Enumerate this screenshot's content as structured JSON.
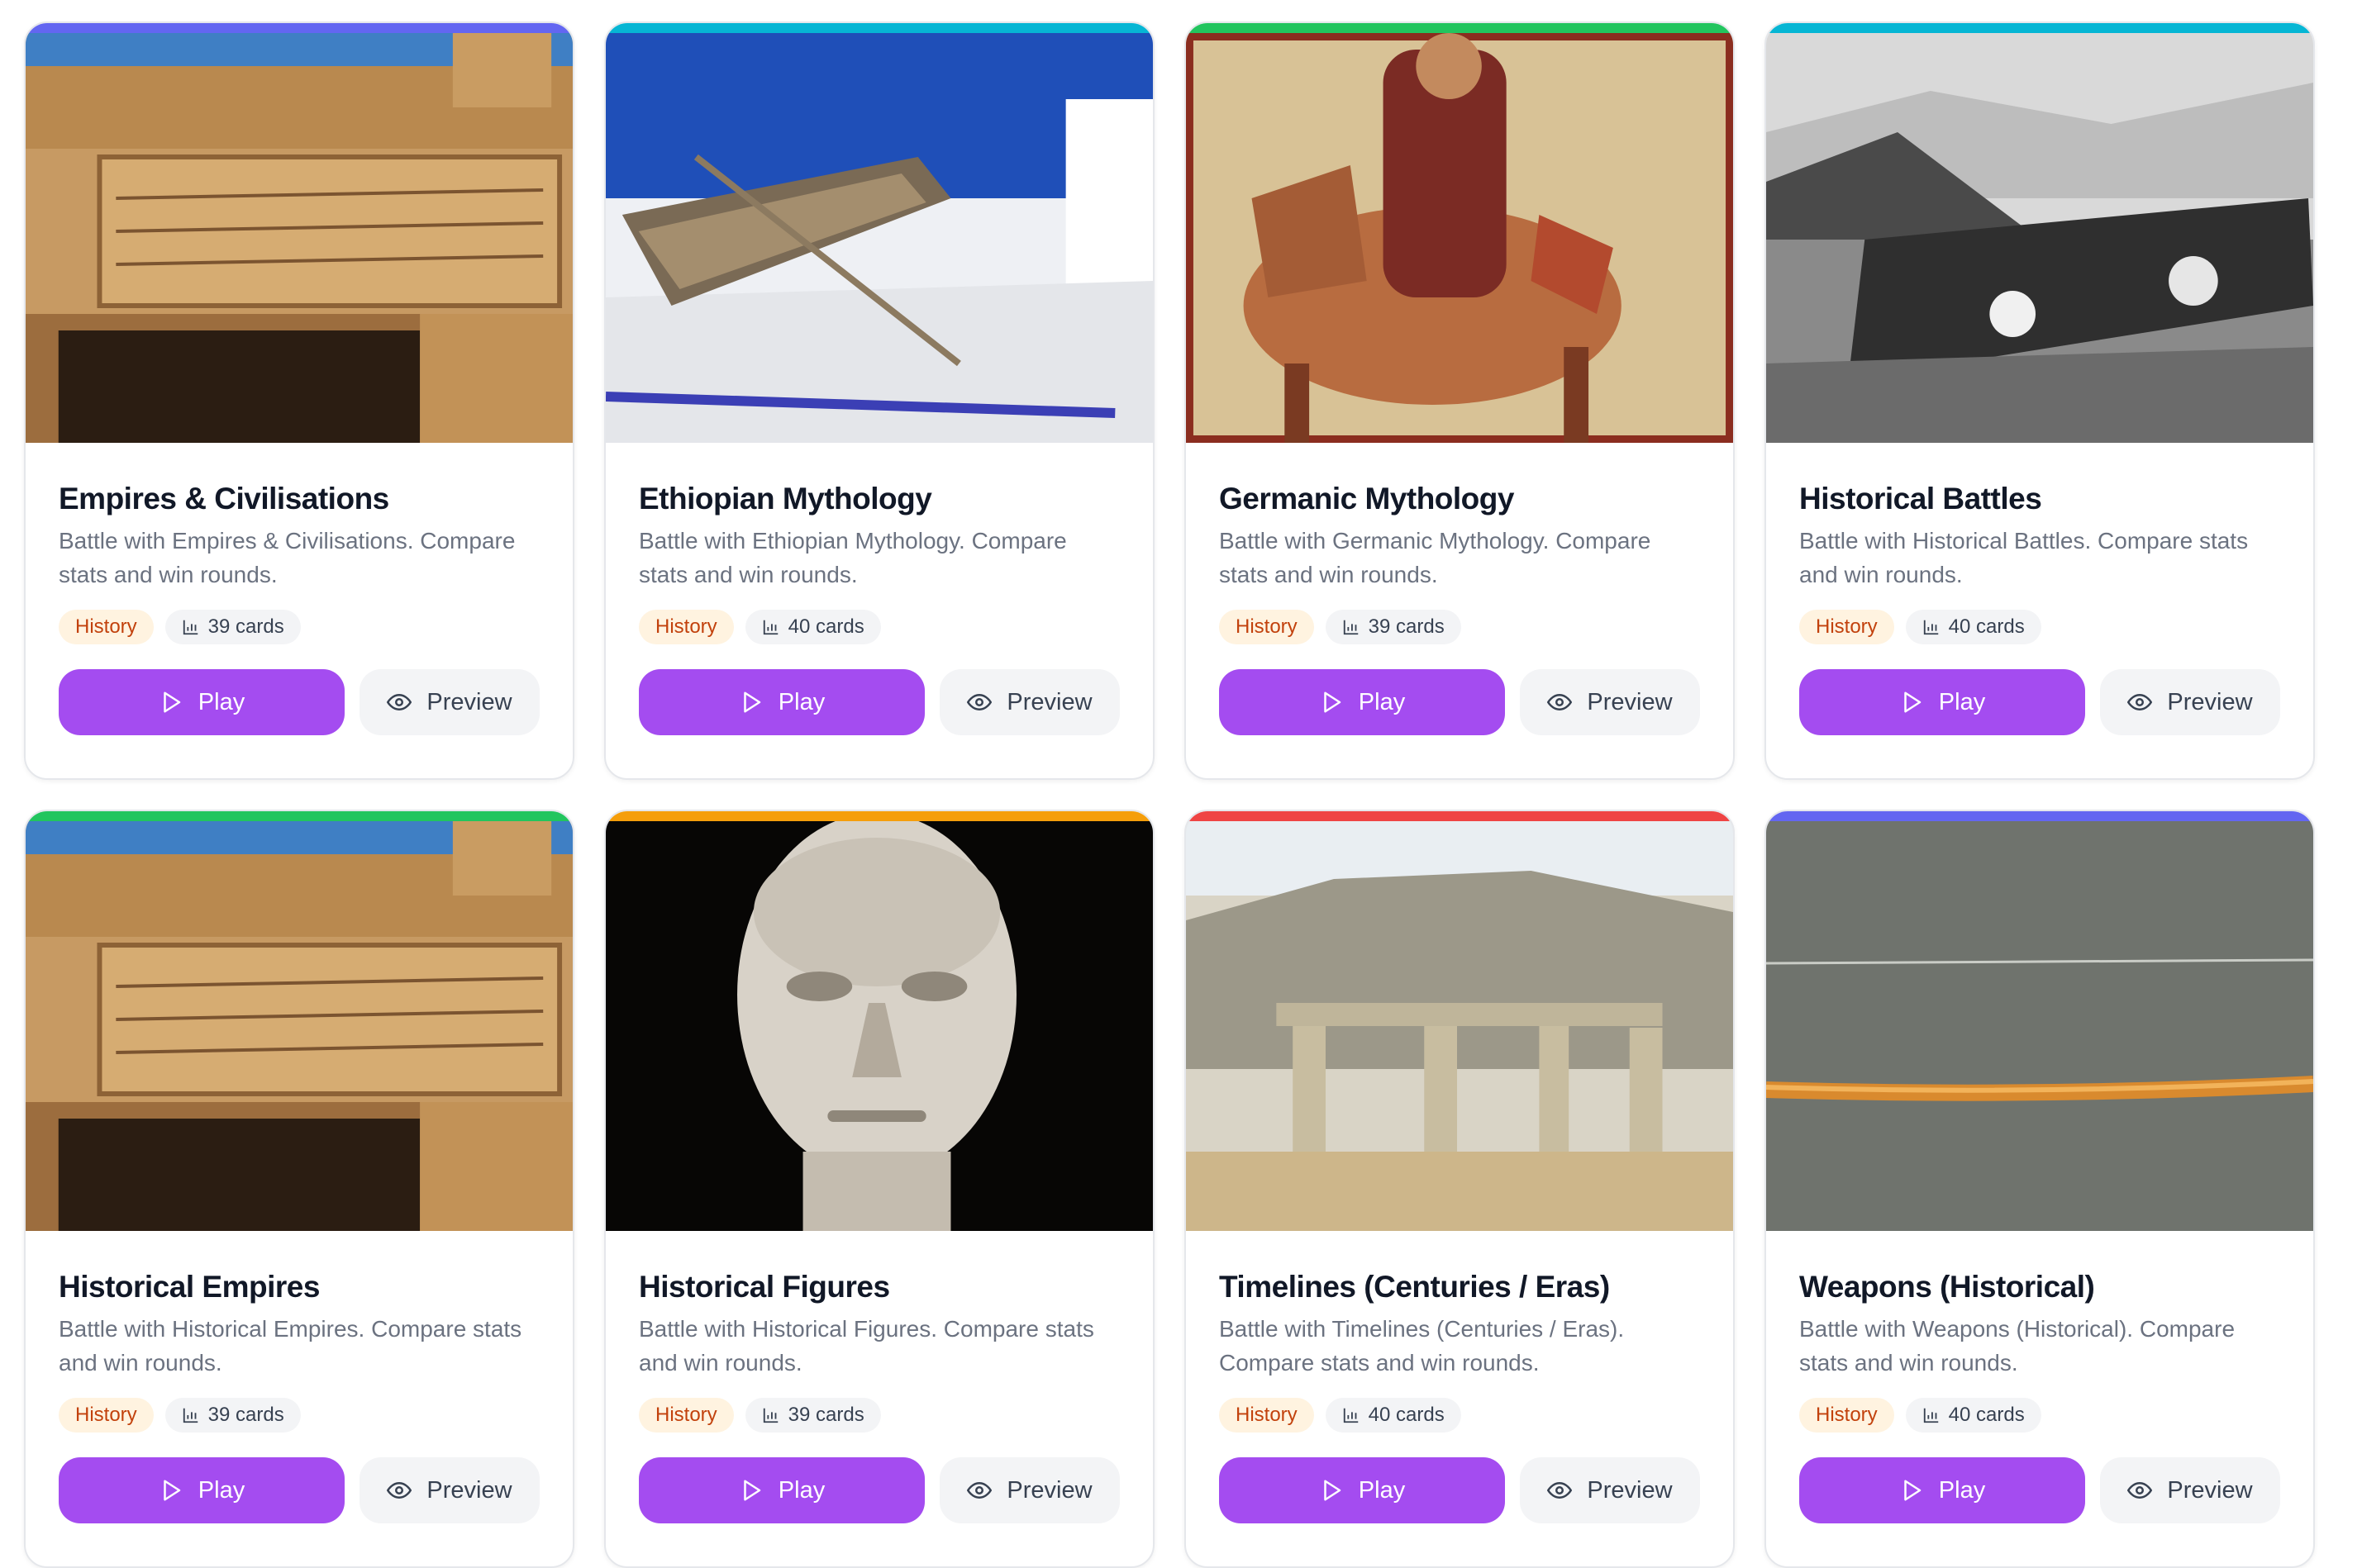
{
  "cards": [
    {
      "title": "Empires & Civilisations",
      "description": "Battle with Empires & Civilisations. Compare stats and win rounds.",
      "category": "History",
      "count": "39 cards",
      "play_label": "Play",
      "preview_label": "Preview",
      "accent": "#6366f1",
      "image": "stone-inscription"
    },
    {
      "title": "Ethiopian Mythology",
      "description": "Battle with Ethiopian Mythology. Compare stats and win rounds.",
      "category": "History",
      "count": "40 cards",
      "play_label": "Play",
      "preview_label": "Preview",
      "accent": "#06b6d4",
      "image": "boat-by-sea"
    },
    {
      "title": "Germanic Mythology",
      "description": "Battle with Germanic Mythology. Compare stats and win rounds.",
      "category": "History",
      "count": "39 cards",
      "play_label": "Play",
      "preview_label": "Preview",
      "accent": "#22c55e",
      "image": "medieval-rider"
    },
    {
      "title": "Historical Battles",
      "description": "Battle with Historical Battles. Compare stats and win rounds.",
      "category": "History",
      "count": "40 cards",
      "play_label": "Play",
      "preview_label": "Preview",
      "accent": "#06b6d4",
      "image": "battle-engraving"
    },
    {
      "title": "Historical Empires",
      "description": "Battle with Historical Empires. Compare stats and win rounds.",
      "category": "History",
      "count": "39 cards",
      "play_label": "Play",
      "preview_label": "Preview",
      "accent": "#22c55e",
      "image": "stone-inscription"
    },
    {
      "title": "Historical Figures",
      "description": "Battle with Historical Figures. Compare stats and win rounds.",
      "category": "History",
      "count": "39 cards",
      "play_label": "Play",
      "preview_label": "Preview",
      "accent": "#f59e0b",
      "image": "marble-bust"
    },
    {
      "title": "Timelines (Centuries / Eras)",
      "description": "Battle with Timelines (Centuries / Eras). Compare stats and win rounds.",
      "category": "History",
      "count": "40 cards",
      "play_label": "Play",
      "preview_label": "Preview",
      "accent": "#ef4444",
      "image": "megalithic-temple"
    },
    {
      "title": "Weapons (Historical)",
      "description": "Battle with Weapons (Historical). Compare stats and win rounds.",
      "category": "History",
      "count": "40 cards",
      "play_label": "Play",
      "preview_label": "Preview",
      "accent": "#6366f1",
      "image": "wooden-bow"
    }
  ]
}
